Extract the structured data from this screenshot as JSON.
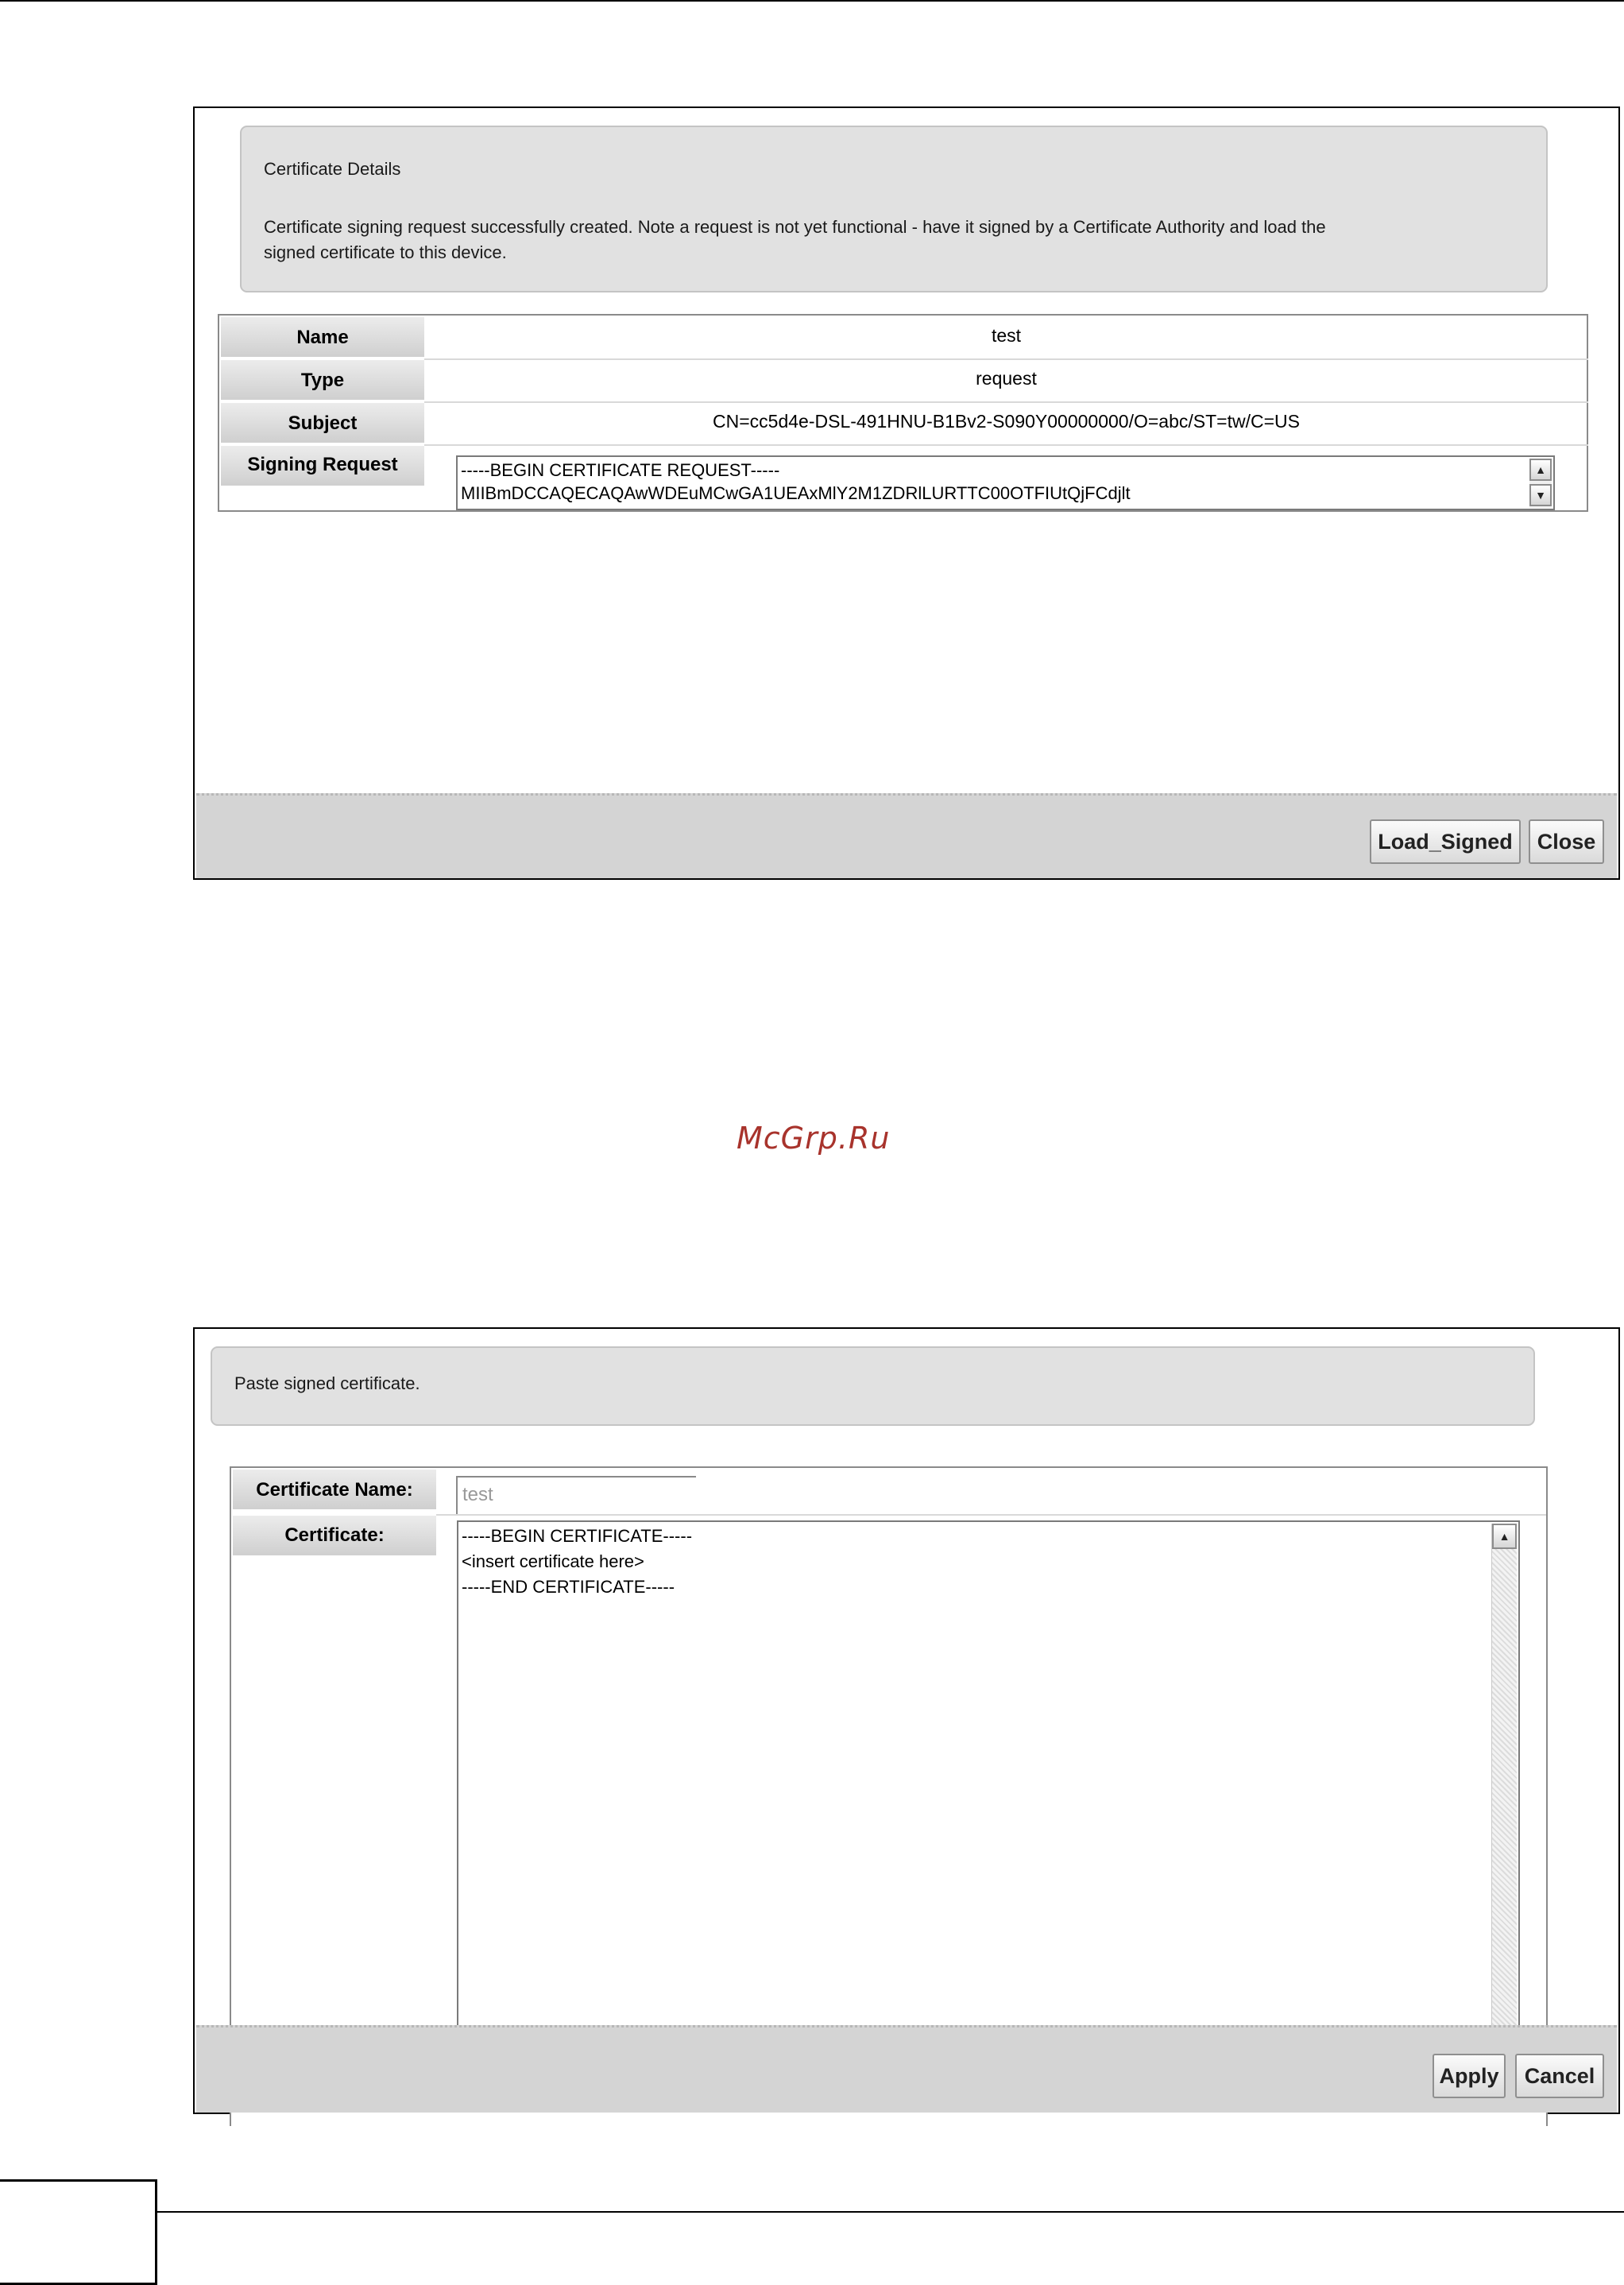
{
  "dialog1": {
    "title": "Certificate Details",
    "message_line1": "Certificate signing request successfully created. Note a request is not yet functional - have it signed by a Certificate Authority and load the",
    "message_line2": "signed certificate to this device.",
    "rows": [
      {
        "label": "Name",
        "value": "test"
      },
      {
        "label": "Type",
        "value": "request"
      },
      {
        "label": "Subject",
        "value": "CN=cc5d4e-DSL-491HNU-B1Bv2-S090Y00000000/O=abc/ST=tw/C=US"
      }
    ],
    "signing_request_label": "Signing Request",
    "signing_request_text": "-----BEGIN CERTIFICATE REQUEST-----\nMIIBmDCCAQECAQAwWDEuMCwGA1UEAxMlY2M1ZDRlLURTTC00OTFIUtQjFCdjlt",
    "buttons": {
      "load_signed": "Load_Signed",
      "close": "Close"
    }
  },
  "watermark": "McGrp.Ru",
  "dialog2": {
    "message": "Paste signed certificate.",
    "certificate_name_label": "Certificate Name:",
    "certificate_name_value": "test",
    "certificate_label": "Certificate:",
    "certificate_text": "-----BEGIN CERTIFICATE-----\n<insert certificate here>\n-----END CERTIFICATE-----",
    "buttons": {
      "apply": "Apply",
      "cancel": "Cancel"
    }
  },
  "icons": {
    "scroll_up": "arrow-up-icon",
    "scroll_down": "arrow-down-icon"
  }
}
